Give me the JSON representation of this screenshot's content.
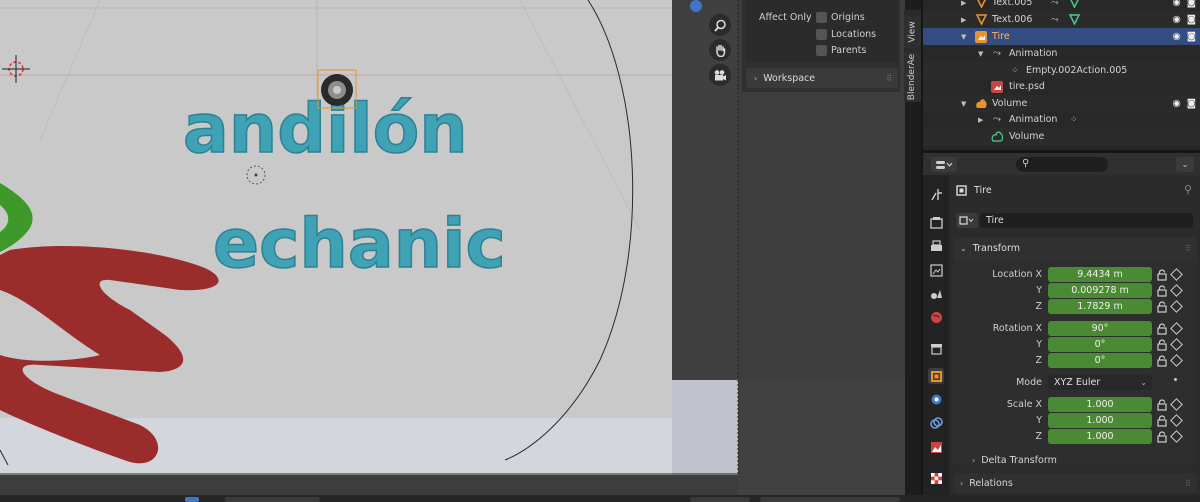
{
  "viewport": {
    "text_objects": [
      "andilón",
      "echanic"
    ],
    "npanel": {
      "affect_only_label": "Affect Only",
      "options": [
        {
          "label": "Origins",
          "checked": false
        },
        {
          "label": "Locations",
          "checked": false
        },
        {
          "label": "Parents",
          "checked": false
        }
      ],
      "workspace_label": "Workspace"
    },
    "side_tabs": [
      "View",
      "BlenderAe"
    ],
    "nav_icons": [
      "zoom-icon",
      "pan-hand-icon",
      "camera-icon"
    ]
  },
  "outliner": {
    "rows": [
      {
        "label": "Text.005",
        "icon": "text-object-icon",
        "indent": 1,
        "selected": false,
        "expander": "collapsed"
      },
      {
        "label": "Text.006",
        "icon": "text-object-icon",
        "indent": 1,
        "selected": false,
        "expander": "collapsed"
      },
      {
        "label": "Tire",
        "icon": "image-empty-icon",
        "indent": 1,
        "selected": true,
        "expander": "expanded"
      },
      {
        "label": "Animation",
        "icon": "animation-icon",
        "indent": 2,
        "selected": false,
        "expander": "expanded"
      },
      {
        "label": "Empty.002Action.005",
        "icon": "action-icon",
        "indent": 3,
        "selected": false,
        "expander": "none"
      },
      {
        "label": "tire.psd",
        "icon": "image-icon",
        "indent": 2,
        "selected": false,
        "expander": "none"
      },
      {
        "label": "Volume",
        "icon": "volume-object-icon",
        "indent": 1,
        "selected": false,
        "expander": "expanded"
      },
      {
        "label": "Animation",
        "icon": "animation-icon",
        "indent": 2,
        "selected": false,
        "expander": "collapsed"
      },
      {
        "label": "Volume",
        "icon": "volume-data-icon",
        "indent": 2,
        "selected": false,
        "expander": "none"
      }
    ]
  },
  "properties": {
    "object_name_header": "Tire",
    "object_name_field": "Tire",
    "transform": {
      "title": "Transform",
      "location_label": "Location X",
      "location": [
        "9.4434 m",
        "0.009278 m",
        "1.7829 m"
      ],
      "rotation_label": "Rotation X",
      "rotation": [
        "90°",
        "0°",
        "0°"
      ],
      "mode_label": "Mode",
      "mode_value": "XYZ Euler",
      "scale_label": "Scale X",
      "scale": [
        "1.000",
        "1.000",
        "1.000"
      ],
      "axis_y": "Y",
      "axis_z": "Z"
    },
    "delta_transform": "Delta Transform",
    "relations": "Relations"
  },
  "colors": {
    "field_green": "#4a8a32",
    "selection_blue": "#334d80",
    "text_teal": "#3fa3b5",
    "swoosh_red": "#9b2c2c",
    "swoosh_green": "#3d9a2a",
    "origin_orange": "#e8932f"
  }
}
